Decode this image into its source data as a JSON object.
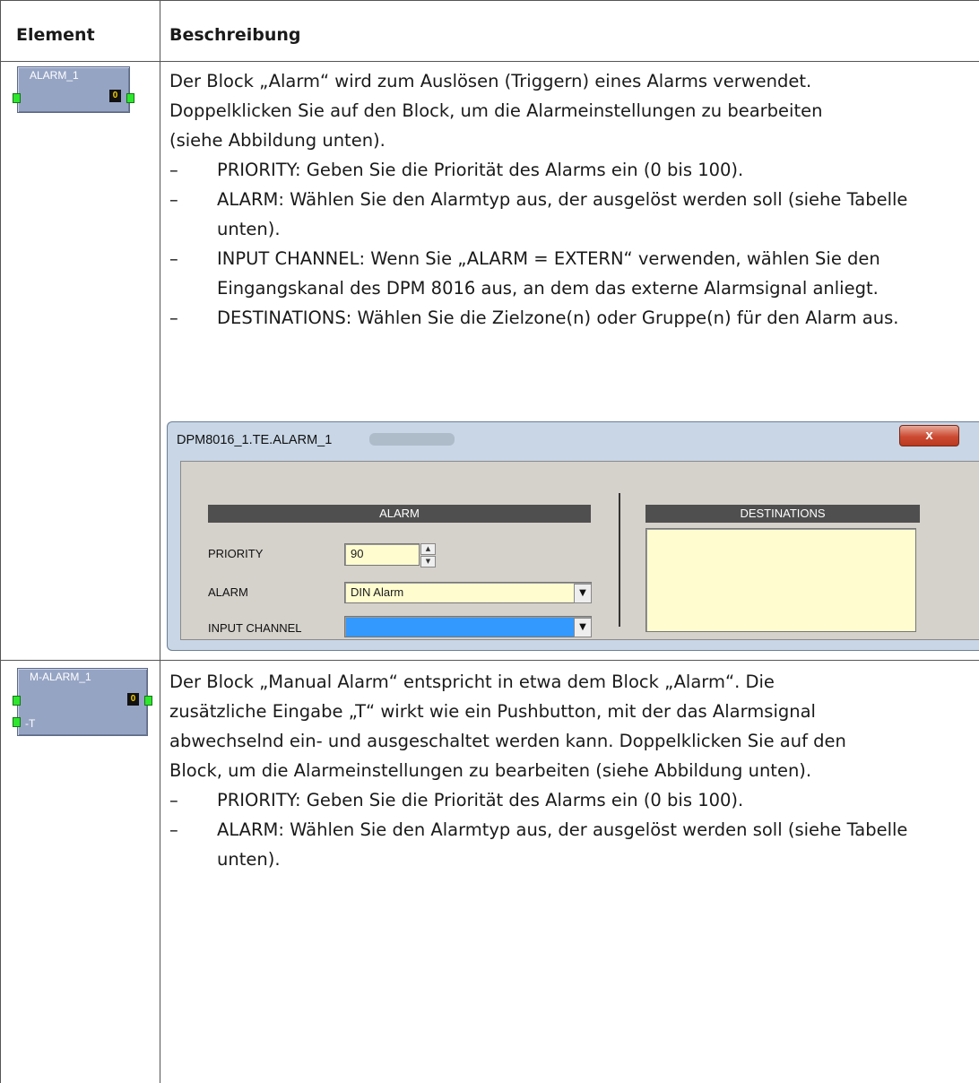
{
  "table": {
    "header": {
      "element": "Element",
      "description": "Beschreibung"
    },
    "rows": [
      {
        "block": {
          "title": "ALARM_1",
          "counter": "0"
        },
        "intro": [
          "Der Block „Alarm“ wird zum Auslösen (Triggern) eines Alarms verwendet.",
          "Doppelklicken Sie auf den Block, um die Alarmeinstellungen zu bearbeiten",
          "(siehe Abbildung unten)."
        ],
        "bullets": [
          "PRIORITY: Geben Sie die Priorität des Alarms ein (0 bis 100).",
          "ALARM: Wählen Sie den Alarmtyp aus, der ausgelöst werden soll (siehe Tabelle unten).",
          "INPUT CHANNEL: Wenn Sie „ALARM = EXTERN“ verwenden, wählen Sie den Eingangskanal des DPM 8016 aus, an dem das externe Alarmsignal anliegt.",
          "DESTINATIONS: Wählen Sie die Zielzone(n) oder Gruppe(n) für den Alarm aus."
        ]
      },
      {
        "block": {
          "title": "M-ALARM_1",
          "counter": "0",
          "input": "-T"
        },
        "intro": [
          "Der Block „Manual Alarm“ entspricht in etwa dem Block „Alarm“. Die",
          "zusätzliche Eingabe „T“ wirkt wie ein Pushbutton, mit der das Alarmsignal",
          "abwechselnd ein- und ausgeschaltet werden kann. Doppelklicken Sie auf den",
          "Block, um die Alarmeinstellungen zu bearbeiten (siehe Abbildung unten)."
        ],
        "bullets": [
          "PRIORITY: Geben Sie die Priorität des Alarms ein (0 bis 100).",
          "ALARM: Wählen Sie den Alarmtyp aus, der ausgelöst werden soll (siehe Tabelle unten)."
        ]
      }
    ]
  },
  "dialog": {
    "title": "DPM8016_1.TE.ALARM_1",
    "close": "x",
    "alarm_section": "ALARM",
    "destinations_section": "DESTINATIONS",
    "priority_label": "PRIORITY",
    "priority_value": "90",
    "alarm_label": "ALARM",
    "alarm_value": "DIN Alarm",
    "input_channel_label": "INPUT CHANNEL",
    "input_channel_value": ""
  },
  "dash": "–",
  "colors": {
    "block": "#96a4c4",
    "pin": "#2ee62e",
    "field": "#fffdd0",
    "selection": "#3399ff"
  }
}
